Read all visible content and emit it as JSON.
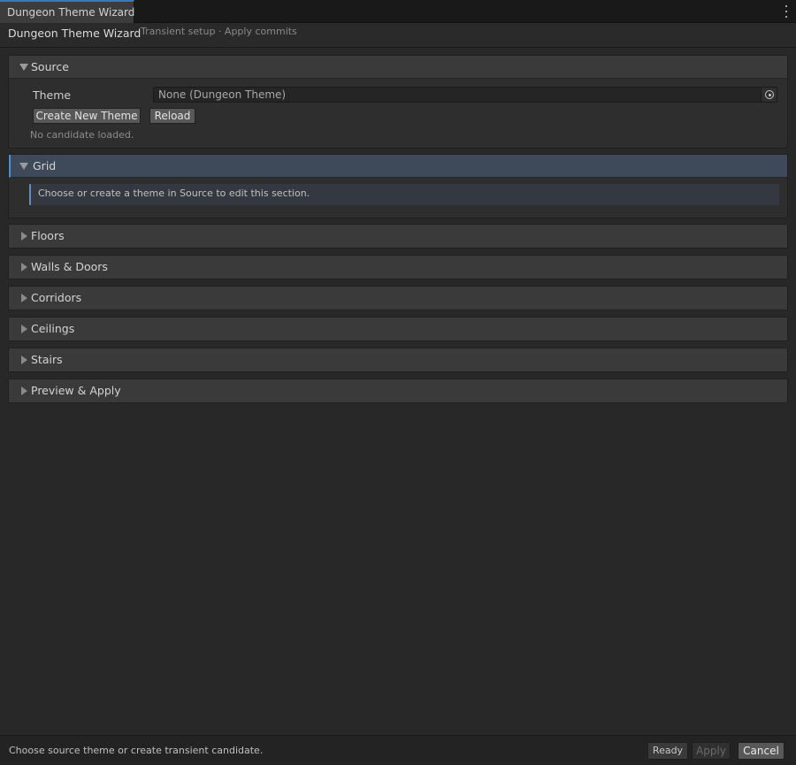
{
  "window": {
    "tab_label": "Dungeon Theme Wizard"
  },
  "header": {
    "title": "Dungeon Theme Wizard",
    "subtitle": "Transient setup · Apply commits"
  },
  "source": {
    "label": "Source",
    "theme_label": "Theme",
    "theme_value": "None (Dungeon Theme)",
    "create_button": "Create New Theme",
    "reload_button": "Reload",
    "hint": "No candidate loaded."
  },
  "grid": {
    "label": "Grid",
    "info": "Choose or create a theme in Source to edit this section."
  },
  "sections": [
    {
      "label": "Floors"
    },
    {
      "label": "Walls & Doors"
    },
    {
      "label": "Corridors"
    },
    {
      "label": "Ceilings"
    },
    {
      "label": "Stairs"
    },
    {
      "label": "Preview & Apply"
    }
  ],
  "footer": {
    "status": "Choose source theme or create transient candidate.",
    "ready_label": "Ready",
    "apply_label": "Apply",
    "cancel_label": "Cancel"
  },
  "colors": {
    "accent": "#4f8fd6",
    "background": "#282828"
  }
}
